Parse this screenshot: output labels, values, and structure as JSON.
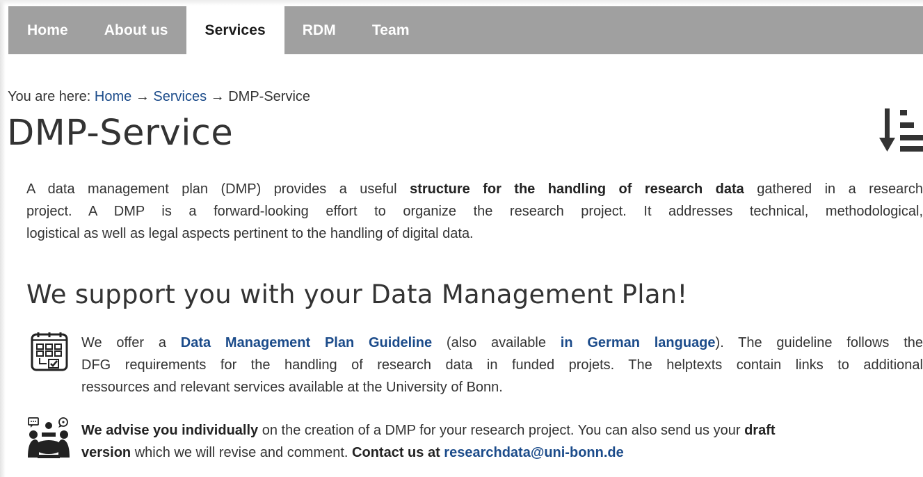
{
  "nav": {
    "items": [
      {
        "label": "Home"
      },
      {
        "label": "About us"
      },
      {
        "label": "Services"
      },
      {
        "label": "RDM"
      },
      {
        "label": "Team"
      }
    ],
    "active": "Services"
  },
  "breadcrumb": {
    "prefix": "You are here:",
    "home": "Home",
    "services": "Services",
    "current": "DMP-Service",
    "separator": "→"
  },
  "page": {
    "title": "DMP-Service",
    "sort_icon": "sort-descending-icon"
  },
  "intro": {
    "l1_a": "A data management plan (DMP) provides a useful ",
    "l1_b": "structure for the handling of research data",
    "l1_c": " gathered in a research",
    "l2": "project. A DMP is a forward-looking effort to organize the research project. It addresses technical, methodological,",
    "l3": "logistical as well as legal aspects pertinent to the handling of digital data."
  },
  "support": {
    "heading": "We support you with your Data Management Plan!",
    "guide": {
      "icon": "checklist-icon",
      "l1_a": "We offer a ",
      "l1_link1": "Data Management Plan Guideline",
      "l1_b": " (also available ",
      "l1_link2": "in German language",
      "l1_c": "). The guideline follows the",
      "l2": "DFG requirements for the handling of research data in funded projets. The helptexts contain links to additional",
      "l3": "ressources and relevant services available at the University of Bonn."
    },
    "advise": {
      "icon": "consultation-icon",
      "l1_bold": "We advise you individually",
      "l1_b": " on the creation of a DMP for your research project. You can also send us your ",
      "l1_bold2": "draft",
      "l2_bold": "version",
      "l2_b": " which we will revise and comment. ",
      "l2_bold2": "Contact us at ",
      "email": "researchdata@uni-bonn.de"
    }
  }
}
